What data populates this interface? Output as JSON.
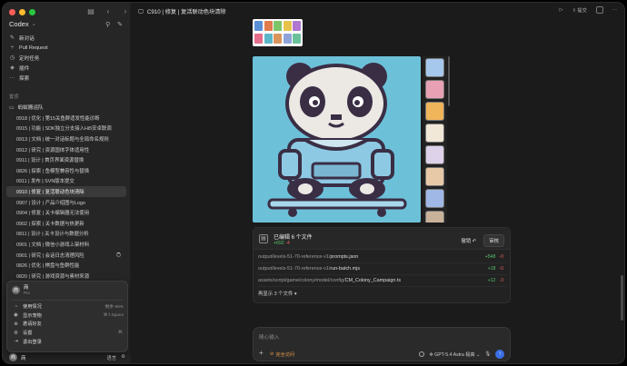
{
  "sidebar": {
    "brand": "Codex",
    "nav": [
      {
        "icon": "compose-icon",
        "glyph": "✎",
        "label": "新对话"
      },
      {
        "icon": "pull-request-icon",
        "glyph": "⑂",
        "label": "Pull Request"
      },
      {
        "icon": "clock-icon",
        "glyph": "◷",
        "label": "定时任务"
      },
      {
        "icon": "plugin-icon",
        "glyph": "◈",
        "label": "插件"
      },
      {
        "icon": "more-icon",
        "glyph": "···",
        "label": "探索"
      }
    ],
    "section_label": "置顶",
    "project": "蚂蚁搬运队",
    "threads": [
      "0918 | 优化 | 第15关鱼群适发性能诊断",
      "0915 | 功能 | SDK独立分支接入Hi5安卓联调",
      "0913 | 文档 | 统一对话标题与全局命名规则",
      "0912 | 研究 | 资源国体字体适用性",
      "0911 | 设计 | 首页界面资源替换",
      "0826 | 探索 | 鱼模型兼容性与替换",
      "0911 | 发布 | SVN版本提交",
      "0910 | 修复 | 复活联动色块清除",
      "0907 | 设计 | 产品介绍图与Logo",
      "0904 | 修复 | 关卡编辑器无法使用",
      "0902 | 探索 | 关卡数据与热更新",
      "0811 | 设计 | 关卡设计与数据分析",
      "0901 | 文档 | 微信小游戏上架材料",
      "0901 | 研究 | 会话日志清理风险",
      "0826 | 优化 | 棋盘与鱼群性能",
      "0820 | 研究 | 游戏资源与素材来源"
    ],
    "active_index": 7,
    "account": {
      "avatar": "商",
      "name": "商",
      "plan": "Pro",
      "items": [
        {
          "icon": "usage-icon",
          "glyph": "◔",
          "label": "使用情况",
          "right": "剩余 98%"
        },
        {
          "icon": "pet-icon",
          "glyph": "◉",
          "label": "显示宠物",
          "right": "⌘⇧Space"
        },
        {
          "icon": "invite-icon",
          "glyph": "⊕",
          "label": "邀请好友",
          "right": ""
        },
        {
          "icon": "settings-icon",
          "glyph": "⚙",
          "label": "设置",
          "right": "⌘,"
        },
        {
          "icon": "logout-icon",
          "glyph": "⇥",
          "label": "退出登录",
          "right": ""
        }
      ]
    },
    "bottom": {
      "avatar": "商",
      "name": "商",
      "lang": "语言"
    }
  },
  "titlebar": {
    "title": "C910 | 修复 | 复活联动色块清除",
    "share": "提交",
    "more": "···"
  },
  "changes": {
    "title": "已编辑 6 个文件",
    "added": "+692",
    "removed": "-4",
    "undo": "撤销 ↶",
    "review": "审核",
    "files": [
      {
        "path": "output/levels-51-70-reference-v1/",
        "name": "prompts.json",
        "add": "+548",
        "del": "-0"
      },
      {
        "path": "output/levels-51-70-reference-v1/",
        "name": "run-batch.mjs",
        "add": "+18",
        "del": "-0"
      },
      {
        "path": "assets/script/game/colony/model/config/",
        "name": "CM_Colony_Campaign.ts",
        "add": "+12",
        "del": "-3"
      }
    ],
    "show_more": "再显示 3 个文件 ▾"
  },
  "composer": {
    "placeholder": "随心输入",
    "access": "完全访问",
    "model": "GPT-5.4 Astra",
    "speed": "极高"
  },
  "colors": {
    "accent": "#3b6fe6",
    "added": "#57c26a",
    "removed": "#e26161",
    "sky": "#6cc1d9"
  }
}
